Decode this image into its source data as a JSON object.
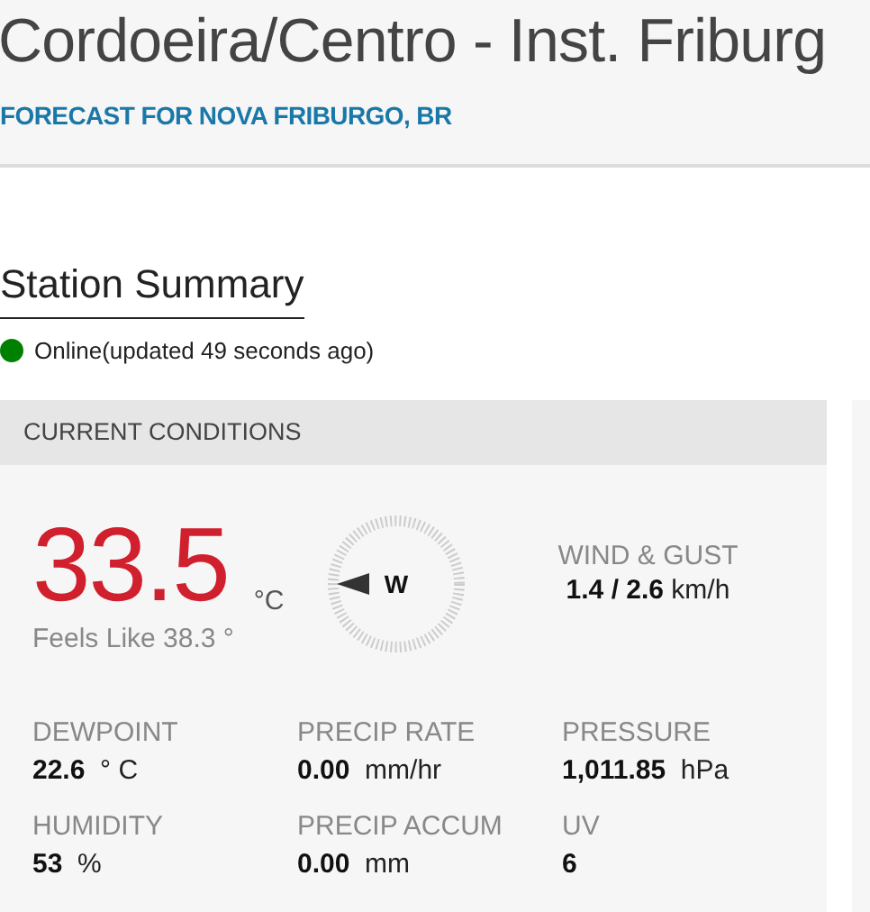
{
  "header": {
    "title": "Cordoeira/Centro - Inst. Friburg",
    "forecast_link": "FORECAST FOR NOVA FRIBURGO, BR"
  },
  "section": {
    "heading": "Station Summary"
  },
  "status": {
    "text": "Online(updated 49 seconds ago)",
    "color": "#008000"
  },
  "current_conditions": {
    "header": "CURRENT CONDITIONS",
    "temperature": "33.5",
    "unit": "°C",
    "feels_like": "Feels Like 38.3 °",
    "wind": {
      "direction": "W",
      "label": "WIND & GUST",
      "speed": "1.4",
      "gust": "/ 2.6",
      "unit": "km/h"
    },
    "stats": [
      {
        "label": "DEWPOINT",
        "value": "22.6",
        "unit": "° C"
      },
      {
        "label": "PRECIP RATE",
        "value": "0.00",
        "unit": "mm/hr"
      },
      {
        "label": "PRESSURE",
        "value": "1,011.85",
        "unit": "hPa"
      },
      {
        "label": "HUMIDITY",
        "value": "53",
        "unit": "%"
      },
      {
        "label": "PRECIP ACCUM",
        "value": "0.00",
        "unit": "mm"
      },
      {
        "label": "UV",
        "value": "6"
      }
    ]
  }
}
